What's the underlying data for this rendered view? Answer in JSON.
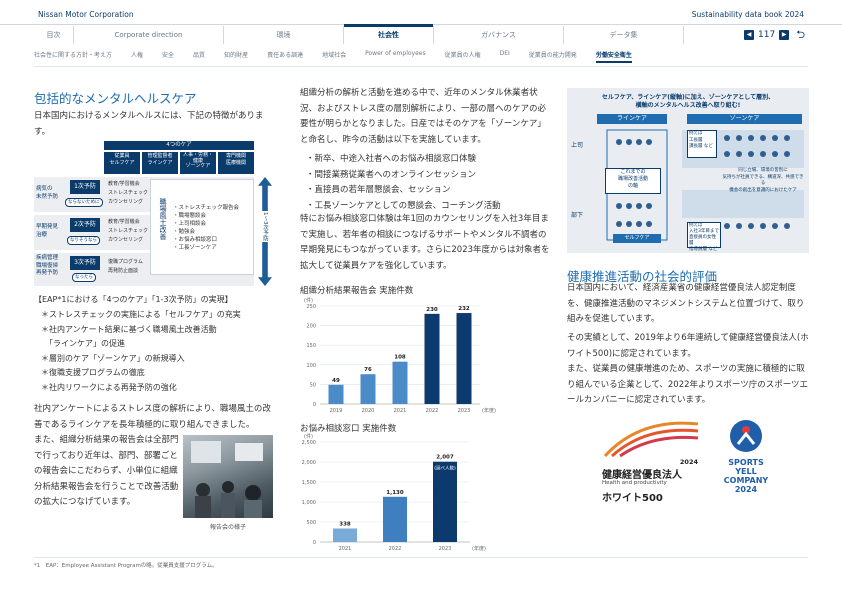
{
  "header": {
    "company": "Nissan Motor Corporation",
    "report": "Sustainability data book 2024"
  },
  "nav": {
    "items": [
      "目次",
      "Corporate direction",
      "環境",
      "社会性",
      "ガバナンス",
      "データ集"
    ],
    "active_index": 3,
    "page": "117"
  },
  "subnav": {
    "items": [
      "社会性に関する方針・考え方",
      "人権",
      "安全",
      "品質",
      "知的財産",
      "責任ある調達",
      "地域社会",
      "Power of employees",
      "従業員の人権",
      "DEI",
      "従業員の能力開発",
      "労働安全衛生"
    ],
    "active": "労働安全衛生"
  },
  "left": {
    "title": "包括的なメンタルヘルスケア",
    "intro": "日本国内におけるメンタルヘルスには、下記の特徴があります。",
    "diagram": {
      "header": "4つのケア",
      "cols": [
        "従業員\nセルフケア",
        "管理監督者\nラインケア",
        "人事・労務・\n健康\nゾーンケア",
        "専門機関\n医療機関"
      ],
      "rows": [
        {
          "label": "病気の\n未然予防",
          "level": "1次予防",
          "tag": "ならないために",
          "items": "教育/学習機会\nストレスチェック\nカウンセリング"
        },
        {
          "label": "早期発見\n治療",
          "level": "2次予防",
          "tag": "なりそうなら",
          "items": "教育/学習機会\nストレスチェック\nカウンセリング"
        },
        {
          "label": "疾病管理\n職場復帰\n再発予防",
          "level": "3次予防",
          "tag": "なったら",
          "items": "復職プログラム\n再発防止面談"
        }
      ],
      "vertical_box": "職場風土改善",
      "vertical_items": [
        "・ストレスチェック報告会",
        "・職場懇談会",
        "・上司相談会",
        "・勉強会",
        "・お悩み相談窓口",
        "・工長ゾーンケア"
      ],
      "side_arrow": "1〜3次予防"
    },
    "eap_title": "【EAP*1における「4つのケア」「1-3次予防」の実現】",
    "eap_items": [
      "＊ストレスチェックの実施による「セルフケア」の充実",
      "＊社内アンケート結果に基づく職場風土改善活動",
      "　「ラインケア」の促進",
      "＊層別のケア「ゾーンケア」の新規導入",
      "＊復職支援プログラムの徹底",
      "＊社内リワークによる再発予防の強化"
    ],
    "para1": "社内アンケートによるストレス度の解析により、職場風土の改善であるラインケアを長年積極的に取り組んできました。",
    "para2": "また、組織分析結果の報告会は全部門で行っており近年は、部門、部署ごとの報告会にこだわらず、小単位に組織分析結果報告会を行うことで改善活動の拡大につなげています。",
    "photo_caption": "報告会の様子"
  },
  "middle": {
    "para1": "組織分析の解析と活動を進める中で、近年のメンタル休業者状況、およびストレス度の層別解析により、一部の層へのケアの必要性が明らかとなりました。日産ではそのケアを「ゾーンケア」と命名し、昨今の活動は以下を実施しています。",
    "list": [
      "・新卒、中途入社者へのお悩み相談窓口体験",
      "・間接業務従業者へのオンラインセッション",
      "・直接員の若年層懇談会、セッション",
      "・工長ゾーンケアとしての懇談会、コーチング活動"
    ],
    "para2": "特にお悩み相談窓口体験は年1回のカウンセリングを入社3年目まで実施し、若年者の相談につなげるサポートやメンタル不調者の早期発見にもつながっています。さらに2023年度からは対象者を拡大して従業員ケアを強化しています。",
    "chart1_title": "組織分析結果報告会 実施件数",
    "chart2_title": "お悩み相談窓口 実施件数"
  },
  "right": {
    "illus_title": "セルフケア、ラインケア(縦軸)に加え、ゾーンケアとして層別、\n横軸のメンタルヘルス改善へ取り組む!",
    "illus_line": "ラインケア",
    "illus_zone": "ゾーンケア",
    "illus_upper": "上司",
    "illus_lower": "部下",
    "illus_self": "セルフケア",
    "illus_box1": "これまでの\n職場改善活動\nの軸",
    "illus_tag1": "例えば\n工長層\n課長層 など",
    "illus_box2": "同じ立場、環境の皆別に\n気持ちが社員できる、構道深、共感できる\n機会の創出を意識的におけたケア",
    "illus_tag2": "例えば\n入社3年目まで\n直接員の女性層\n指導員層 など",
    "title": "健康推進活動の社会的評価",
    "para1": "日本国内において、経済産業省の健康経営優良法人認定制度を、健康推進活動のマネジメントシステムと位置づけて、取り組みを促進しています。",
    "para2": "その実績として、2019年より6年連続して健康経営優良法人(ホワイト500)に認定されています。",
    "para3": "また、従業員の健康増進のため、スポーツの実施に積極的に取り組んでいる企業として、2022年よりスポーツ庁のスポーツエールカンパニーに認定されています。",
    "logo1_year": "2024",
    "logo1_name": "健康経営優良法人",
    "logo1_en": "Health and productivity",
    "logo1_sub": "ホワイト500",
    "logo2_lines": [
      "SPORTS",
      "YELL",
      "COMPANY",
      "2024"
    ]
  },
  "footnote": "*1　EAP：Employee Assistant Programの略。従業員支援プログラム。",
  "colors": {
    "navy": "#0a3b6b",
    "blue": "#2e7ab8",
    "title_blue": "#1f6db0"
  },
  "chart_data": [
    {
      "type": "bar",
      "title": "組織分析結果報告会 実施件数",
      "ylabel": "(件)",
      "xlabel": "(年度)",
      "categories": [
        "2019",
        "2020",
        "2021",
        "2022",
        "2023"
      ],
      "values": [
        49,
        76,
        108,
        230,
        232
      ],
      "ylim": [
        0,
        250
      ],
      "yticks": [
        0,
        50,
        100,
        150,
        200,
        250
      ],
      "grid": true
    },
    {
      "type": "bar",
      "title": "お悩み相談窓口 実施件数",
      "ylabel": "(件)",
      "xlabel": "(年度)",
      "categories": [
        "2021",
        "2022",
        "2023"
      ],
      "values": [
        338,
        1130,
        2007
      ],
      "value_labels": [
        "338",
        "1,130",
        "2,007"
      ],
      "note": "(延べ人数)",
      "ylim": [
        0,
        2500
      ],
      "yticks": [
        "0",
        "500",
        "1,000",
        "1,500",
        "2,000",
        "2,500"
      ],
      "grid": true
    }
  ]
}
